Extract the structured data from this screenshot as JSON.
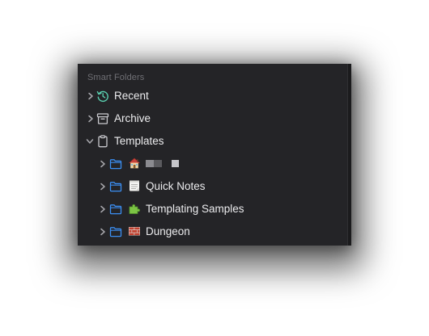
{
  "section": {
    "title": "Smart Folders"
  },
  "items": [
    {
      "label": "Recent",
      "icon": "clock-history-icon",
      "expanded": false
    },
    {
      "label": "Archive",
      "icon": "archive-box-icon",
      "expanded": false
    },
    {
      "label": "Templates",
      "icon": "clipboard-icon",
      "expanded": true
    }
  ],
  "template_children": [
    {
      "label": "",
      "emoji": "house-emoji",
      "icon": "folder-icon",
      "redacted": true
    },
    {
      "label": "Quick Notes",
      "emoji": "notepad-emoji",
      "icon": "folder-icon"
    },
    {
      "label": "Templating Samples",
      "emoji": "puzzle-piece-emoji",
      "icon": "folder-icon"
    },
    {
      "label": "Dungeon",
      "emoji": "brick-wall-emoji",
      "icon": "folder-icon"
    }
  ],
  "colors": {
    "panel_bg": "#242427",
    "text": "#ececee",
    "muted": "#6f6f74",
    "folder_accent": "#3b8ff3",
    "recent_accent": "#5ad0b0"
  }
}
